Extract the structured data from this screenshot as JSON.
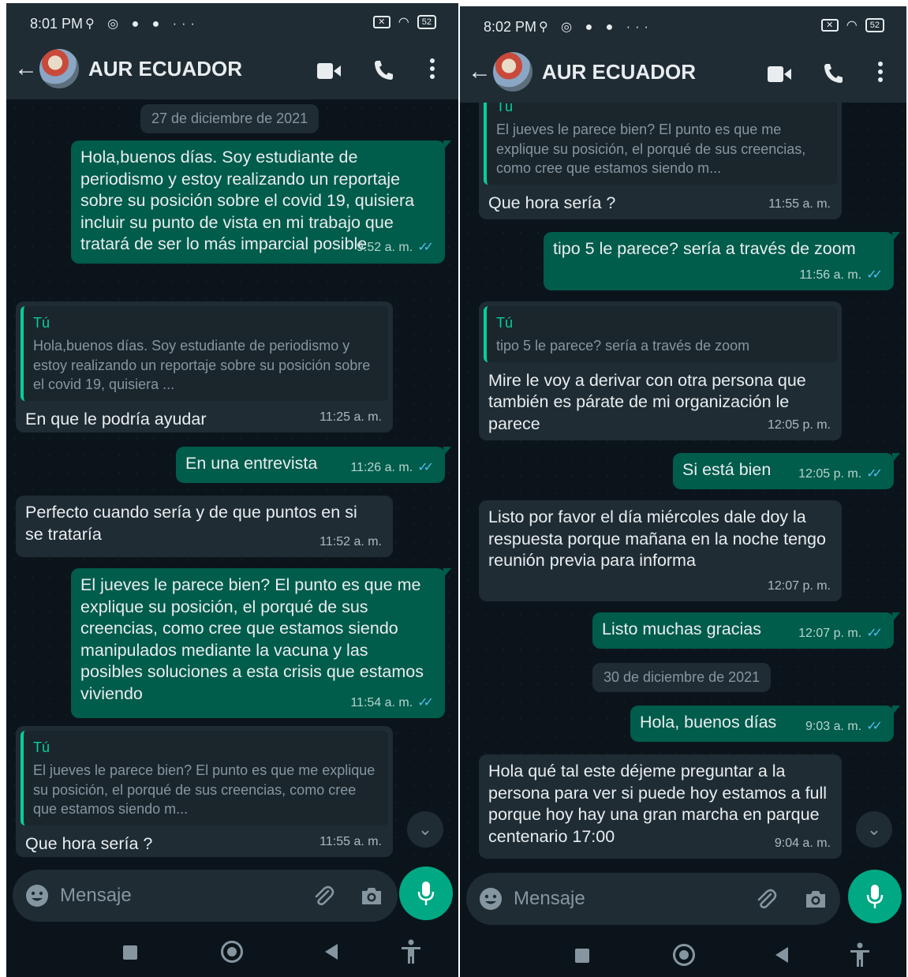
{
  "left": {
    "status": {
      "time": "8:01 PM",
      "icons": "⚲ ◎ ● ● ···",
      "battery": "52"
    },
    "header": {
      "contact_name": "AUR ECUADOR"
    },
    "date_chip": "27 de diciembre de 2021",
    "messages": [
      {
        "text": "Hola,buenos días. Soy estudiante de periodismo y estoy realizando un reportaje sobre su posición sobre el covid 19, quisiera incluir su punto de vista en mi trabajo que tratará de ser lo más imparcial posible",
        "time": "9:52 a. m."
      },
      {
        "quote_name": "Tú",
        "quote_text": "Hola,buenos días. Soy estudiante de periodismo y estoy realizando un reportaje sobre su posición sobre el covid 19, quisiera ...",
        "text": "En que le podría ayudar",
        "time": "11:25 a. m."
      },
      {
        "text": "En una entrevista",
        "time": "11:26 a. m."
      },
      {
        "text": "Perfecto cuando sería y de que puntos en si se trataría",
        "time": "11:52 a. m."
      },
      {
        "text": "El jueves le parece bien? El punto es que me explique su posición, el porqué de sus creencias, como cree que estamos siendo manipulados mediante la vacuna y las posibles soluciones a esta crisis que estamos viviendo",
        "time": "11:54 a. m."
      },
      {
        "quote_name": "Tú",
        "quote_text": "El jueves le parece bien? El punto es que me explique su posición, el porqué de sus creencias, como cree que estamos siendo m...",
        "text": "Que hora sería ?",
        "time": "11:55 a. m."
      }
    ],
    "input": {
      "placeholder": "Mensaje"
    }
  },
  "right": {
    "status": {
      "time": "8:02 PM",
      "icons": "⚲ ◎ ● ● ···",
      "battery": "52"
    },
    "header": {
      "contact_name": "AUR ECUADOR"
    },
    "messages": [
      {
        "quote_name": "Tú",
        "quote_text": "El jueves le parece bien? El punto es que me explique su posición, el porqué de sus creencias, como cree que estamos siendo m...",
        "text": "Que hora sería ?",
        "time": "11:55 a. m."
      },
      {
        "text": "tipo 5 le parece? sería a través de zoom",
        "time": "11:56 a. m."
      },
      {
        "quote_name": "Tú",
        "quote_text": "tipo 5 le parece? sería a través de zoom",
        "text": "Mire le voy a derivar con otra persona que también es párate de mi organización le parece",
        "time": "12:05 p. m."
      },
      {
        "text": "Si está bien",
        "time": "12:05 p. m."
      },
      {
        "text": "Listo por favor el día miércoles dale doy la respuesta porque mañana en la noche tengo reunión previa para informa",
        "time": "12:07 p. m."
      },
      {
        "text": "Listo muchas gracias",
        "time": "12:07 p. m."
      },
      {
        "text": "Hola, buenos días",
        "time": "9:03 a. m."
      },
      {
        "text": "Hola qué tal este déjeme preguntar a la persona para ver si puede hoy estamos a full porque hoy hay una gran marcha en parque centenario 17:00",
        "time": "9:04 a. m."
      }
    ],
    "date_chip": "30 de diciembre de 2021",
    "input": {
      "placeholder": "Mensaje"
    }
  },
  "colors": {
    "background": "#0b141a",
    "bar": "#1f2c34",
    "outgoing": "#005c4b",
    "incoming": "#1f2c34",
    "accent": "#00a884",
    "read_ticks": "#53bdeb"
  },
  "icons": [
    "back-arrow-icon",
    "video-call-icon",
    "phone-icon",
    "more-options-icon",
    "emoji-icon",
    "attach-clip-icon",
    "camera-icon",
    "microphone-icon",
    "scroll-down-icon"
  ]
}
